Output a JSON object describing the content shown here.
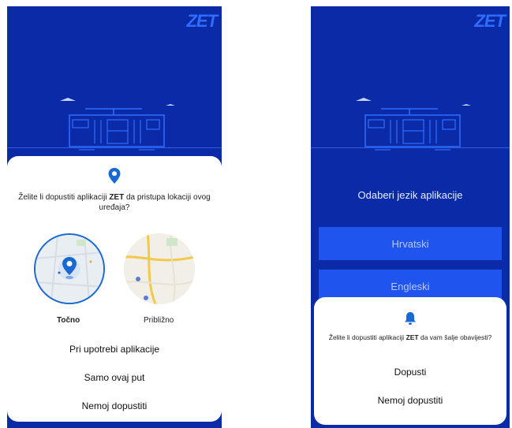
{
  "brand": {
    "logo_text": "ZET",
    "background_color": "#0a2aa8",
    "accent_color": "#1a68d4"
  },
  "left_screen": {
    "permission_dialog": {
      "icon": "location-pin-icon",
      "question_prefix": "Želite li dopustiti aplikaciji ",
      "question_app": "ZET",
      "question_suffix": " da pristupa lokaciji ovog uređaja?",
      "precise_label": "Točno",
      "approximate_label": "Približno",
      "options": [
        "Pri upotrebi aplikacije",
        "Samo ovaj put",
        "Nemoj dopustiti"
      ]
    }
  },
  "right_screen": {
    "language_prompt": "Odaberi jezik aplikacije",
    "languages": [
      "Hrvatski",
      "Engleski"
    ],
    "notification_dialog": {
      "icon": "bell-icon",
      "question_prefix": "Želite li dopustiti aplikaciji ",
      "question_app": "ZET",
      "question_suffix": " da vam šalje obavijesti?",
      "options": [
        "Dopusti",
        "Nemoj dopustiti"
      ]
    }
  }
}
